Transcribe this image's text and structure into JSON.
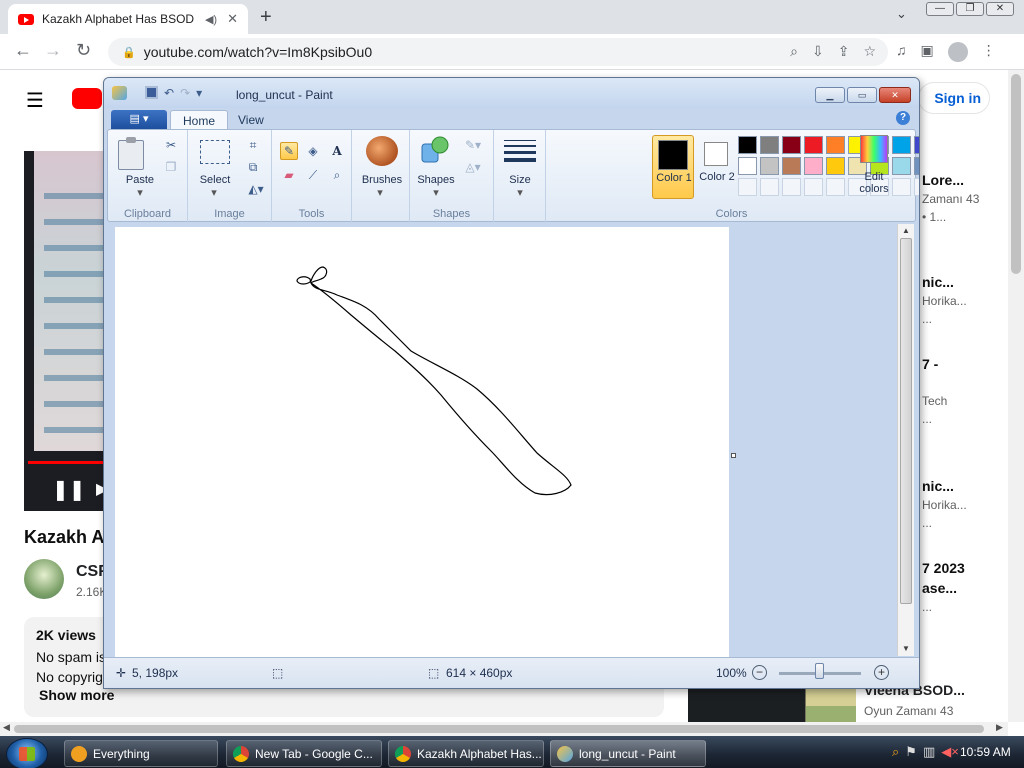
{
  "browser": {
    "tab_title": "Kazakh Alphabet Has BSOD",
    "url": "youtube.com/watch?v=Im8KpsibOu0"
  },
  "youtube": {
    "signin_label": "Sign in",
    "video_title": "Kazakh A",
    "channel_name": "CSF",
    "channel_subs": "2.16K",
    "views": "2K views",
    "desc_line1": "No spam is",
    "desc_line2": "No copyrig",
    "show_more": "Show more",
    "recommended": [
      {
        "title": "Lore...",
        "sub1": "Zamanı 43",
        "sub2": "• 1..."
      },
      {
        "title": "nic...",
        "sub1": "Horika...",
        "sub2": "..."
      },
      {
        "title": "7 -",
        "sub1": "Tech",
        "sub2": "..."
      },
      {
        "title": "nic...",
        "sub1": "Horika...",
        "sub2": "..."
      },
      {
        "title": "7 2023",
        "sub1": "ase...",
        "sub2": "..."
      }
    ],
    "rec_bottom": {
      "title": "Vieena BSOD...",
      "sub": "Oyun Zamanı 43"
    }
  },
  "paint": {
    "title": "long_uncut - Paint",
    "tabs": {
      "home": "Home",
      "view": "View"
    },
    "groups": {
      "clipboard": "Clipboard",
      "image": "Image",
      "tools": "Tools",
      "shapes": "Shapes",
      "colors": "Colors"
    },
    "buttons": {
      "paste": "Paste",
      "select": "Select",
      "brushes": "Brushes",
      "shapes": "Shapes",
      "size": "Size",
      "color1": "Color 1",
      "color2": "Color 2",
      "edit_colors": "Edit colors"
    },
    "palette": [
      "#000000",
      "#7f7f7f",
      "#880015",
      "#ed1c24",
      "#ff7f27",
      "#fff200",
      "#22b14c",
      "#00a2e8",
      "#3f48cc",
      "#a349a4",
      "#ffffff",
      "#c3c3c3",
      "#b97a57",
      "#ffaec9",
      "#ffc90e",
      "#efe4b0",
      "#b5e61d",
      "#99d9ea",
      "#7092be",
      "#c8bfe7",
      "",
      "",
      "",
      "",
      "",
      "",
      "",
      "",
      "",
      ""
    ],
    "status": {
      "cursor": "5, 198px",
      "canvas_size": "614 × 460px",
      "zoom": "100%"
    }
  },
  "taskbar": {
    "items": [
      "Everything",
      "New Tab - Google C...",
      "Kazakh Alphabet Has...",
      "long_uncut - Paint"
    ],
    "clock": "10:59 AM"
  }
}
